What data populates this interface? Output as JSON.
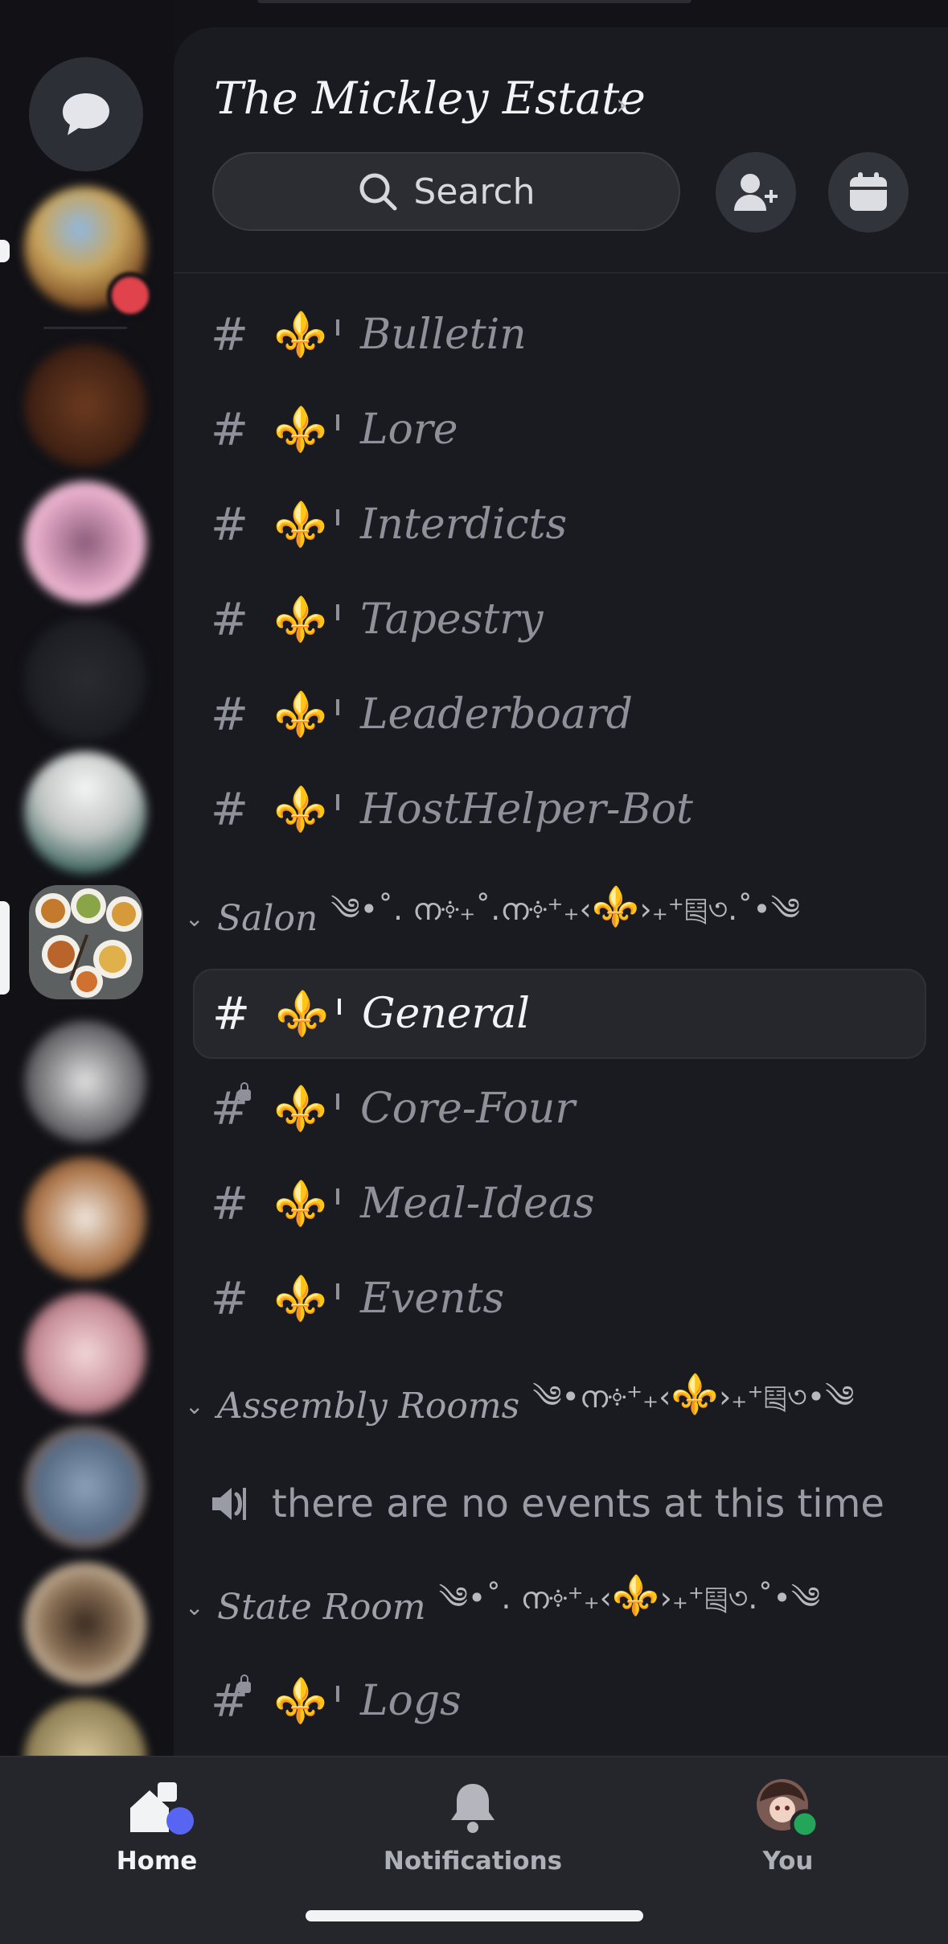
{
  "server": {
    "name": "The Mickley Estate"
  },
  "search": {
    "label": "Search"
  },
  "channels_top": [
    {
      "name": "Bulletin"
    },
    {
      "name": "Lore"
    },
    {
      "name": "Interdicts"
    },
    {
      "name": "Tapestry"
    },
    {
      "name": "Leaderboard"
    },
    {
      "name": "HostHelper-Bot"
    }
  ],
  "categories": [
    {
      "name": "Salon",
      "decor_left": "༄•˚. ന༓₊˚.ന༓⁺₊‹",
      "decor_right": "›₊⁺༕৩.˚•༄"
    },
    {
      "name": "Assembly Rooms",
      "decor_left": "༄•ന༓⁺₊‹",
      "decor_right": "›₊⁺༕৩•༄"
    },
    {
      "name": "State Room",
      "decor_left": "༄•˚. ന༓⁺₊‹",
      "decor_right": "›₊⁺༕৩.˚•༄"
    }
  ],
  "salon_channels": [
    {
      "name": "General",
      "active": true
    },
    {
      "name": "Core-Four",
      "locked": true
    },
    {
      "name": "Meal-Ideas"
    },
    {
      "name": "Events"
    }
  ],
  "assembly": {
    "voice_text": "there are no events at this time"
  },
  "state_room_channels": [
    {
      "name": "Logs",
      "locked": true
    }
  ],
  "glyphs": {
    "hash": "#",
    "fleur": "⚜️",
    "chevron_down": "⌄",
    "chevron_right": "›"
  },
  "bottom_nav": {
    "home": "Home",
    "notifications": "Notifications",
    "you": "You"
  },
  "colors": {
    "background": "#121217",
    "panel": "#1a1b20",
    "accent_blue": "#5865f2",
    "online_green": "#23a55a",
    "gold": "#d9a521"
  }
}
